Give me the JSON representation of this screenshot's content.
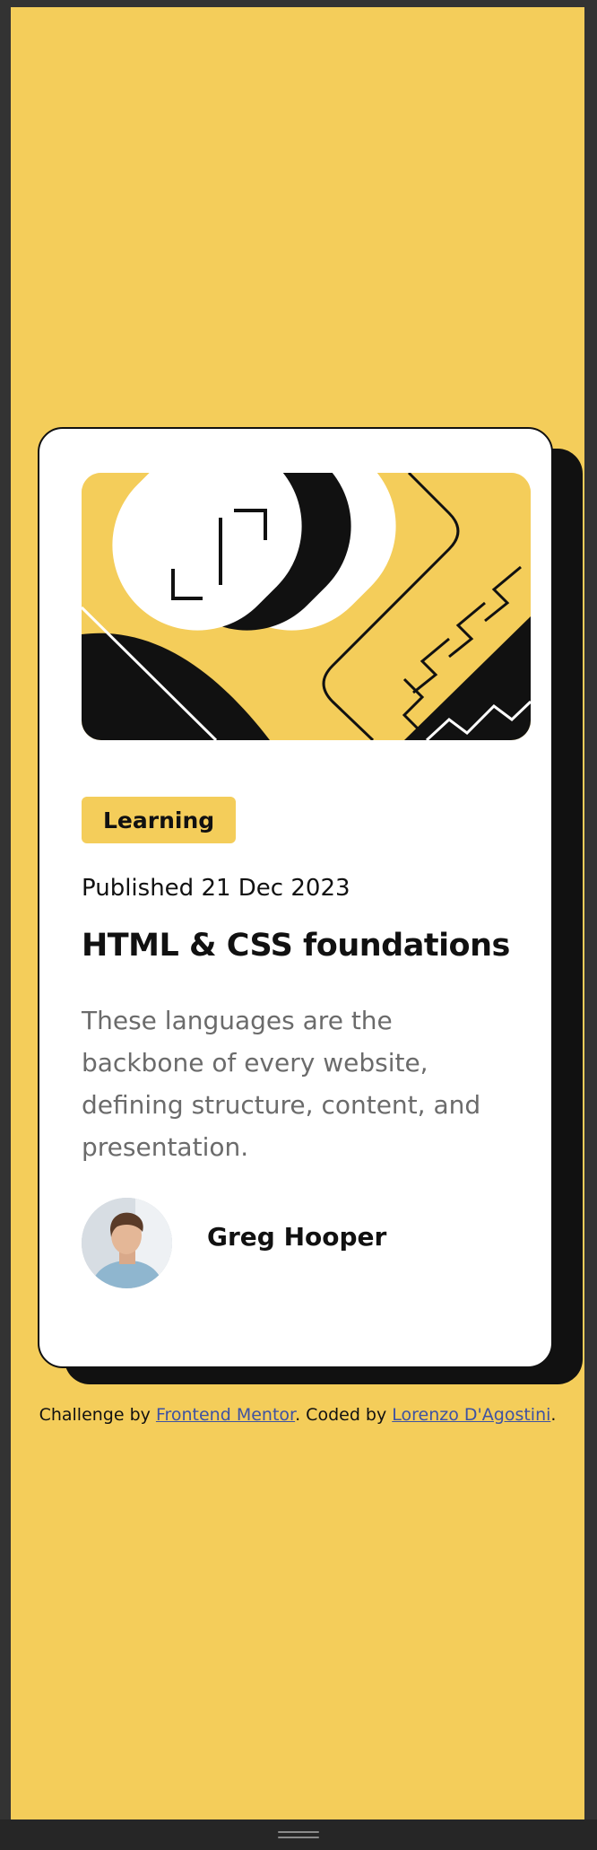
{
  "card": {
    "category": "Learning",
    "published": "Published 21 Dec 2023",
    "title": "HTML & CSS foundations",
    "description": "These languages are the backbone of every website, defining structure, content, and presentation.",
    "author": "Greg Hooper"
  },
  "footer": {
    "prefix": "Challenge by ",
    "link1": "Frontend Mentor",
    "middle": ". Coded by ",
    "link2": "Lorenzo D'Agostini",
    "suffix": "."
  },
  "colors": {
    "accent": "#f4cd5a",
    "ink": "#111111",
    "muted": "#6b6b6b",
    "link": "#3e52a3"
  },
  "icons": {
    "hero": "abstract-illustration",
    "avatar": "author-photo"
  }
}
